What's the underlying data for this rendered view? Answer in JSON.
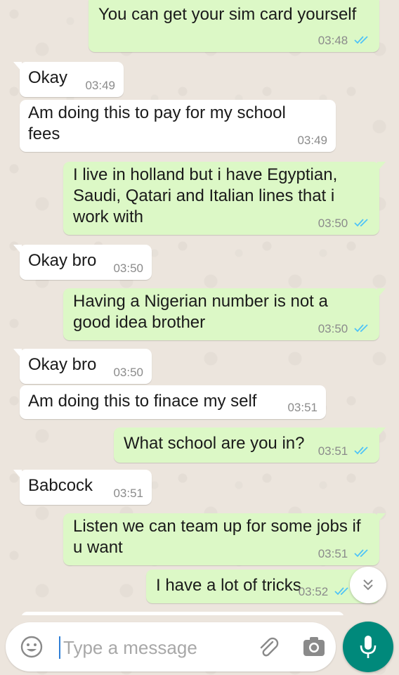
{
  "colors": {
    "outgoing_bubble": "#dcf8c6",
    "incoming_bubble": "#ffffff",
    "tick_read": "#4fc3f7",
    "timestamp": "#8b8b8b",
    "mic_button": "#00897b",
    "wallpaper": "#ece5dd"
  },
  "messages": [
    {
      "dir": "out",
      "text": "You can get your sim card yourself",
      "time": "03:48",
      "status": "read"
    },
    {
      "dir": "in",
      "text": "Okay",
      "time": "03:49"
    },
    {
      "dir": "in",
      "text": "Am doing this to pay for my school fees",
      "time": "03:49"
    },
    {
      "dir": "out",
      "text": "I live in holland but i have Egyptian, Saudi, Qatari and Italian lines that i work with",
      "time": "03:50",
      "status": "read"
    },
    {
      "dir": "in",
      "text": "Okay bro",
      "time": "03:50"
    },
    {
      "dir": "out",
      "text": "Having a Nigerian number is not a good idea brother",
      "time": "03:50",
      "status": "read"
    },
    {
      "dir": "in",
      "text": "Okay bro",
      "time": "03:50"
    },
    {
      "dir": "in",
      "text": "Am doing this to finace my self",
      "time": "03:51"
    },
    {
      "dir": "out",
      "text": "What school are you in?",
      "time": "03:51",
      "status": "read"
    },
    {
      "dir": "in",
      "text": "Babcock",
      "time": "03:51"
    },
    {
      "dir": "out",
      "text": "Listen we can team up for some jobs if u want",
      "time": "03:51",
      "status": "read"
    },
    {
      "dir": "out",
      "text": "I have a lot of tricks",
      "time": "03:52",
      "status": "read"
    }
  ],
  "input": {
    "placeholder": "Type a message",
    "value": ""
  },
  "icons": {
    "emoji": "emoji-icon",
    "attach": "paperclip-icon",
    "camera": "camera-icon",
    "mic": "microphone-icon",
    "scroll_down": "double-chevron-down-icon",
    "read_receipt": "double-check-icon"
  }
}
